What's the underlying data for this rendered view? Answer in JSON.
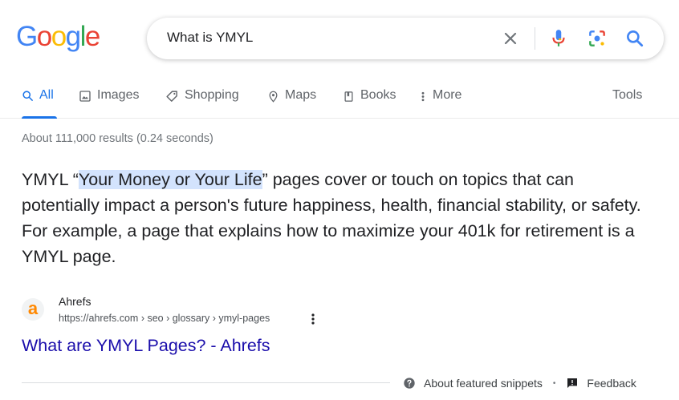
{
  "logo": {
    "letters": [
      "G",
      "o",
      "o",
      "g",
      "l",
      "e"
    ],
    "colors": [
      "#4285f4",
      "#ea4335",
      "#fbbc05",
      "#4285f4",
      "#34a853",
      "#ea4335"
    ]
  },
  "search": {
    "query": "What is YMYL",
    "icons": [
      "close-icon",
      "mic-icon",
      "lens-icon",
      "search-icon"
    ]
  },
  "tabs": [
    {
      "label": "All",
      "icon": "search-icon",
      "active": true
    },
    {
      "label": "Images",
      "icon": "image-icon"
    },
    {
      "label": "Shopping",
      "icon": "tag-icon"
    },
    {
      "label": "Maps",
      "icon": "map-pin-icon"
    },
    {
      "label": "Books",
      "icon": "book-icon"
    },
    {
      "label": "More",
      "icon": "more-vertical-icon"
    }
  ],
  "tools_label": "Tools",
  "stats": "About 111,000 results (0.24 seconds)",
  "snippet": {
    "before": "YMYL “",
    "highlight": "Your Money or Your Life",
    "after": "” pages cover or touch on topics that can potentially impact a person's future happiness, health, financial stability, or safety. For example, a page that explains how to maximize your 401k for retirement is a YMYL page."
  },
  "source": {
    "favicon_letter": "a",
    "name": "Ahrefs",
    "url": "https://ahrefs.com › seo › glossary › ymyl-pages"
  },
  "result_title": "What are YMYL Pages? - Ahrefs",
  "footer": {
    "about": "About featured snippets",
    "separator": "•",
    "feedback": "Feedback"
  },
  "colors": {
    "link": "#1a0dab",
    "accent": "#1a73e8",
    "highlight": "#d3e3fd"
  }
}
